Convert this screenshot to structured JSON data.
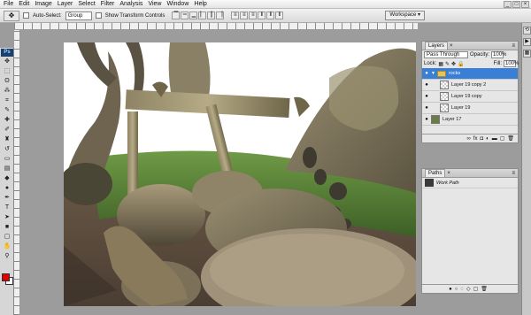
{
  "menu": [
    "File",
    "Edit",
    "Image",
    "Layer",
    "Select",
    "Filter",
    "Analysis",
    "View",
    "Window",
    "Help"
  ],
  "options": {
    "auto_select_label": "Auto-Select:",
    "auto_select_value": "Group",
    "show_transform_label": "Show Transform Controls",
    "workspace_label": "Workspace"
  },
  "toolbox": {
    "logo": "Ps",
    "tools": [
      "move-icon",
      "marquee-icon",
      "lasso-icon",
      "magic-wand-icon",
      "crop-icon",
      "eyedropper-icon",
      "healing-icon",
      "brush-icon",
      "stamp-icon",
      "history-brush-icon",
      "eraser-icon",
      "gradient-icon",
      "blur-icon",
      "dodge-icon",
      "pen-icon",
      "type-icon",
      "path-select-icon",
      "shape-icon",
      "notes-icon",
      "hand-icon",
      "zoom-icon"
    ],
    "foreground_color": "#e10000",
    "background_color": "#ffffff"
  },
  "layers_panel": {
    "tab": "Layers",
    "blend_mode": "Pass Through",
    "opacity_label": "Opacity:",
    "opacity": "100%",
    "lock_label": "Lock:",
    "fill_label": "Fill:",
    "fill": "100%",
    "layers": [
      {
        "name": "rocks",
        "type": "group",
        "selected": true
      },
      {
        "name": "Layer 19 copy 2",
        "type": "layer",
        "selected": false
      },
      {
        "name": "Layer 19 copy",
        "type": "layer",
        "selected": false
      },
      {
        "name": "Layer 19",
        "type": "layer",
        "selected": false
      },
      {
        "name": "Layer 17",
        "type": "image",
        "selected": false
      }
    ]
  },
  "paths_panel": {
    "tab": "Paths",
    "paths": [
      {
        "name": "Work Path"
      }
    ]
  },
  "colors": {
    "selection": "#3a7fd6",
    "ps_logo_bg": "#1a3f6c"
  }
}
